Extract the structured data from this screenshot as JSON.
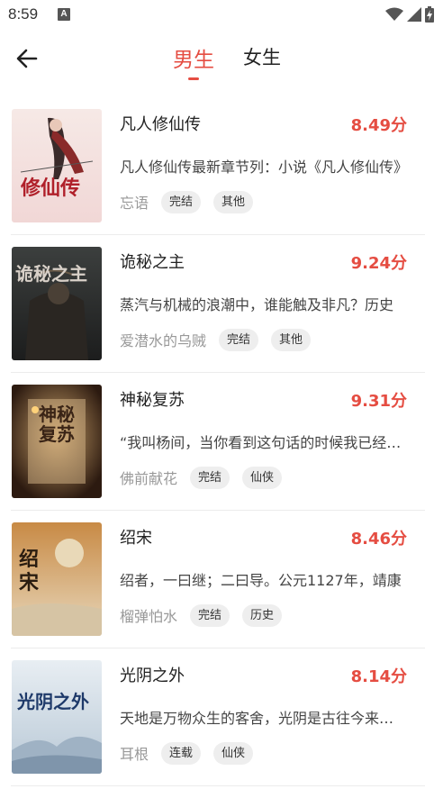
{
  "status": {
    "time": "8:59",
    "notify_glyph": "A"
  },
  "header": {
    "tabs": [
      "男生",
      "女生"
    ],
    "active_tab": "男生"
  },
  "colors": {
    "accent": "#e54d42",
    "tag_bg": "#eeeeee",
    "author": "#999999"
  },
  "books": [
    {
      "title": "凡人修仙传",
      "score": "8.49分",
      "desc": "凡人修仙传最新章节列：小说《凡人修仙传》",
      "author": "忘语",
      "tags": [
        "完结",
        "其他"
      ],
      "cover_text": "修仙传"
    },
    {
      "title": "诡秘之主",
      "score": "9.24分",
      "desc": "蒸汽与机械的浪潮中，谁能触及非凡？历史",
      "author": "爱潜水的乌贼",
      "tags": [
        "完结",
        "其他"
      ],
      "cover_text": "诡秘之主"
    },
    {
      "title": "神秘复苏",
      "score": "9.31分",
      "desc": "“我叫杨间，当你看到这句话的时候我已经死了",
      "author": "佛前献花",
      "tags": [
        "完结",
        "仙侠"
      ],
      "cover_text": "神秘复苏"
    },
    {
      "title": "绍宋",
      "score": "8.46分",
      "desc": "绍者，一曰继；二曰导。公元1127年，靖康",
      "author": "榴弹怕水",
      "tags": [
        "完结",
        "历史"
      ],
      "cover_text": "绍宋"
    },
    {
      "title": "光阴之外",
      "score": "8.14分",
      "desc": "天地是万物众生的客舍，光阴是古往今来的过客",
      "author": "耳根",
      "tags": [
        "连载",
        "仙侠"
      ],
      "cover_text": "光阴之外"
    }
  ]
}
